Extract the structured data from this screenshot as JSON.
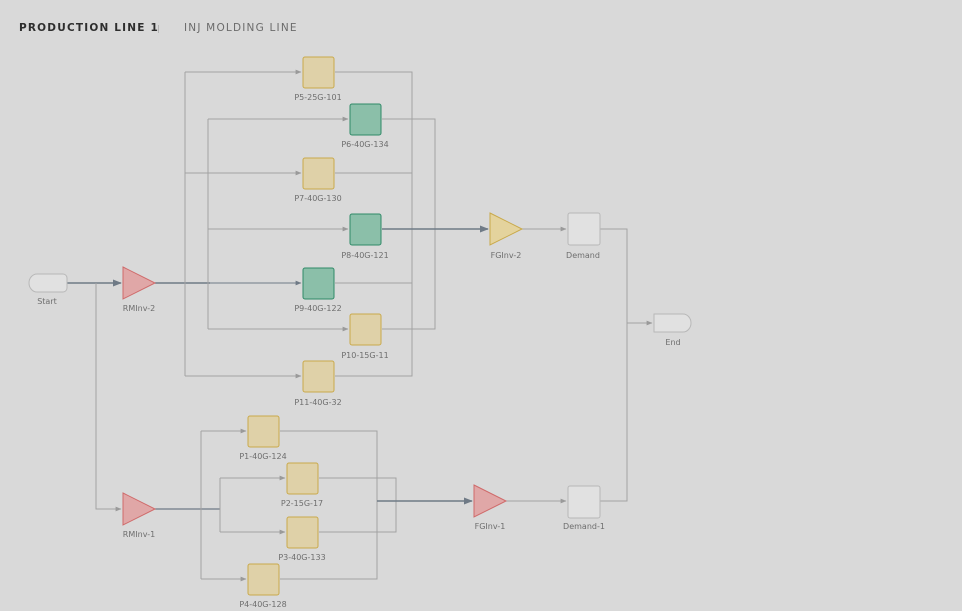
{
  "header": {
    "active_tab": "PRODUCTION LINE 1",
    "separator": "|",
    "inactive_tab": "INJ MOLDING LINE"
  },
  "colors": {
    "background": "#d9d9d9",
    "edge": "#a0a0a0",
    "edge_main": "#6f7a86",
    "process_yellow_fill": "#dfd1a8",
    "process_yellow_stroke": "#c9a94a",
    "process_green_fill": "#8bbfa9",
    "process_green_stroke": "#2f8a67",
    "inventory_red_fill": "#e0a7a7",
    "inventory_red_stroke": "#cf6a6a",
    "inventory_yellow_fill": "#e4d39d",
    "inventory_yellow_stroke": "#c9a94a",
    "demand_fill": "#e1e1e1",
    "demand_stroke": "#b8b8b8"
  },
  "nodes": {
    "start": "Start",
    "end": "End",
    "rminv2": "RMInv-2",
    "rminv1": "RMInv-1",
    "fginv2": "FGInv-2",
    "fginv1": "FGInv-1",
    "demand": "Demand",
    "demand1": "Demand-1",
    "p5": "P5-25G-101",
    "p6": "P6-40G-134",
    "p7": "P7-40G-130",
    "p8": "P8-40G-121",
    "p9": "P9-40G-122",
    "p10": "P10-15G-11",
    "p11": "P11-40G-32",
    "p1": "P1-40G-124",
    "p2": "P2-15G-17",
    "p3": "P3-40G-133",
    "p4": "P4-40G-128"
  }
}
